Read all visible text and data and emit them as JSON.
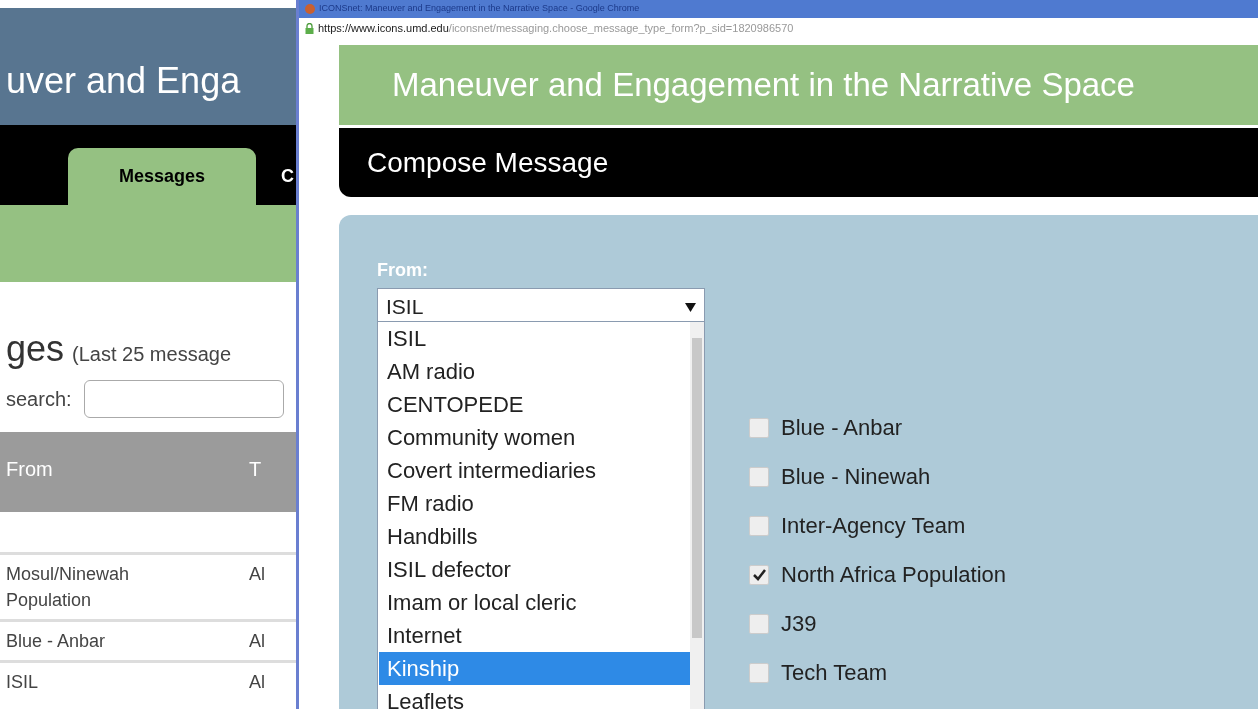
{
  "background_page": {
    "header_title": "uver and Enga",
    "tabs": [
      {
        "label": "Messages",
        "selected": true
      },
      {
        "label": "C",
        "selected": false
      }
    ],
    "heading": "ges",
    "heading_note": "(Last 25 message",
    "search": {
      "label": "search:"
    },
    "table": {
      "columns": [
        "From",
        "T"
      ],
      "rows": [
        [
          "Mosul/Ninewah Population",
          "Al"
        ],
        [
          "Blue - Anbar",
          "Al"
        ],
        [
          "ISIL",
          "Al"
        ]
      ]
    }
  },
  "popup": {
    "window_title": "ICONSnet: Maneuver and Engagement in the Narrative Space - Google Chrome",
    "url": {
      "host": "https://www.icons.umd.edu",
      "path": "/iconsnet/messaging.choose_message_type_form?p_sid=1820986570"
    },
    "site_title": "Maneuver and Engagement in the Narrative Space",
    "section_title": "Compose Message",
    "from": {
      "label": "From:",
      "value": "ISIL",
      "options": [
        {
          "label": "ISIL",
          "highlighted": false
        },
        {
          "label": "AM radio",
          "highlighted": false
        },
        {
          "label": "CENTOPEDE",
          "highlighted": false
        },
        {
          "label": "Community women",
          "highlighted": false
        },
        {
          "label": "Covert intermediaries",
          "highlighted": false
        },
        {
          "label": "FM radio",
          "highlighted": false
        },
        {
          "label": "Handbills",
          "highlighted": false
        },
        {
          "label": "ISIL defector",
          "highlighted": false
        },
        {
          "label": "Imam or local cleric",
          "highlighted": false
        },
        {
          "label": "Internet",
          "highlighted": false
        },
        {
          "label": "Kinship",
          "highlighted": true
        },
        {
          "label": "Leaflets",
          "highlighted": false
        }
      ]
    },
    "recipients": [
      {
        "label": "Blue - Anbar",
        "checked": false
      },
      {
        "label": "Blue - Ninewah",
        "checked": false
      },
      {
        "label": "Inter-Agency Team",
        "checked": false
      },
      {
        "label": "North Africa Population",
        "checked": true
      },
      {
        "label": "J39",
        "checked": false
      },
      {
        "label": "Tech Team",
        "checked": false
      }
    ]
  }
}
